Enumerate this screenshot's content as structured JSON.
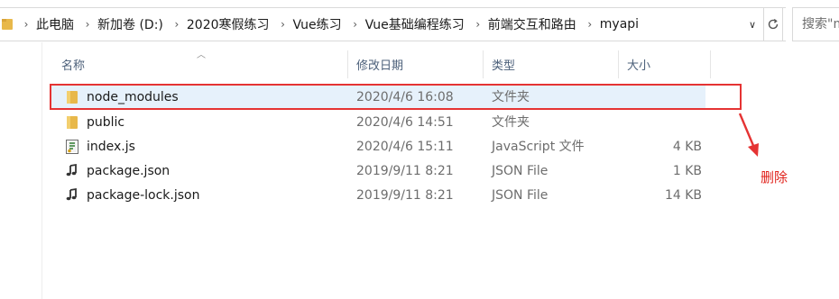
{
  "address": {
    "crumbs": [
      "此电脑",
      "新加卷 (D:)",
      "2020寒假练习",
      "Vue练习",
      "Vue基础编程练习",
      "前端交互和路由",
      "myapi"
    ],
    "search_placeholder": "搜索\"myapi\""
  },
  "columns": {
    "name": "名称",
    "date": "修改日期",
    "type": "类型",
    "size": "大小"
  },
  "files": [
    {
      "name": "node_modules",
      "date": "2020/4/6 16:08",
      "type": "文件夹",
      "size": "",
      "icon": "folder-icon",
      "selected": true
    },
    {
      "name": "public",
      "date": "2020/4/6 14:51",
      "type": "文件夹",
      "size": "",
      "icon": "folder-icon",
      "selected": false
    },
    {
      "name": "index.js",
      "date": "2020/4/6 15:11",
      "type": "JavaScript 文件",
      "size": "4 KB",
      "icon": "js-file-icon",
      "selected": false
    },
    {
      "name": "package.json",
      "date": "2019/9/11 8:21",
      "type": "JSON File",
      "size": "1 KB",
      "icon": "json-file-icon",
      "selected": false
    },
    {
      "name": "package-lock.json",
      "date": "2019/9/11 8:21",
      "type": "JSON File",
      "size": "14 KB",
      "icon": "json-file-icon",
      "selected": false
    }
  ],
  "annotation": {
    "text": "删除",
    "color": "#e53333"
  },
  "colors": {
    "folder": "#e8b84a",
    "selected_row": "#e6f1fb",
    "header_text": "#4c607a"
  }
}
